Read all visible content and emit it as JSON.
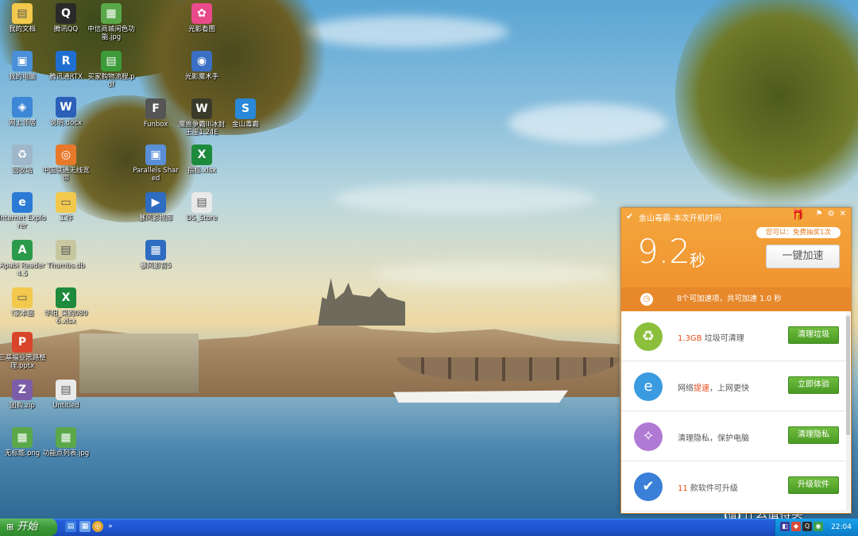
{
  "desktop_icons": [
    {
      "label": "我的文档",
      "icon": "folder-documents-icon",
      "color": "#f2c94c",
      "glyph": "▤"
    },
    {
      "label": "我的电脑",
      "icon": "computer-icon",
      "color": "#4a8fd8",
      "glyph": "▣"
    },
    {
      "label": "网上邻居",
      "icon": "network-icon",
      "color": "#3e86d6",
      "glyph": "◈"
    },
    {
      "label": "回收站",
      "icon": "recycle-bin-icon",
      "color": "#9fb7c9",
      "glyph": "♻"
    },
    {
      "label": "Internet Explorer",
      "icon": "ie-icon",
      "color": "#2b7bd6",
      "glyph": "e"
    },
    {
      "label": "Apabi Reader 4.5",
      "icon": "apabi-reader-icon",
      "color": "#2b9a4a",
      "glyph": "A"
    },
    {
      "label": "!家本届",
      "icon": "folder-icon",
      "color": "#f2c94c",
      "glyph": "▭"
    },
    {
      "label": "三基福业思路整理.pptx",
      "icon": "pptx-icon",
      "color": "#d9452b",
      "glyph": "P"
    },
    {
      "label": "团购.zip",
      "icon": "zip-icon",
      "color": "#7b5ea7",
      "glyph": "Z"
    },
    {
      "label": "无标题.png",
      "icon": "png-icon",
      "color": "#5aa84a",
      "glyph": "▦"
    },
    {
      "label": "腾讯QQ",
      "icon": "qq-icon",
      "color": "#2a2a2a",
      "glyph": "Q"
    },
    {
      "label": "腾讯通RTX",
      "icon": "rtx-icon",
      "color": "#1f6fd1",
      "glyph": "R"
    },
    {
      "label": "说明.docx",
      "icon": "docx-icon",
      "color": "#2b5fb8",
      "glyph": "W"
    },
    {
      "label": "中国联通无线宽带",
      "icon": "unicom-icon",
      "color": "#e8792b",
      "glyph": "◎"
    },
    {
      "label": "工作",
      "icon": "folder-icon",
      "color": "#f2c94c",
      "glyph": "▭"
    },
    {
      "label": "Thumbs.db",
      "icon": "db-file-icon",
      "color": "#c7c7a0",
      "glyph": "▤"
    },
    {
      "label": "华阳_采购0806.xlsx",
      "icon": "xlsx-icon",
      "color": "#1e8a3c",
      "glyph": "X"
    },
    {
      "label": "Untitled",
      "icon": "file-icon",
      "color": "#e9e9e9",
      "glyph": "▤"
    },
    {
      "label": "功能点列表.jpg",
      "icon": "jpg-icon",
      "color": "#5aa84a",
      "glyph": "▦"
    },
    {
      "label": "中信商城闲色功能.jpg",
      "icon": "jpg-icon",
      "color": "#5aa84a",
      "glyph": "▦"
    },
    {
      "label": "买家购物流程.pdf",
      "icon": "pdf-icon",
      "color": "#3c9a38",
      "glyph": "▤"
    },
    {
      "label": "光影看图",
      "icon": "photo-viewer-icon",
      "color": "#e84a8a",
      "glyph": "✿"
    },
    {
      "label": "光影魔术手",
      "icon": "photo-editor-icon",
      "color": "#3a6fc4",
      "glyph": "◉"
    },
    {
      "label": "Funbox",
      "icon": "funbox-icon",
      "color": "#555",
      "glyph": "F"
    },
    {
      "label": "魔兽争霸III冰封王座1.24E",
      "icon": "warcraft-icon",
      "color": "#3a3a2a",
      "glyph": "W"
    },
    {
      "label": "金山毒霸",
      "icon": "kingsoft-icon",
      "color": "#2a88d8",
      "glyph": "S"
    },
    {
      "label": "Parallels Shared",
      "icon": "parallels-icon",
      "color": "#5a8fd8",
      "glyph": "▣"
    },
    {
      "label": "指标.xlsx",
      "icon": "xlsx-icon",
      "color": "#1e8a3c",
      "glyph": "X"
    },
    {
      "label": "暴风影视库",
      "icon": "baofeng-icon",
      "color": "#2e6cc2",
      "glyph": "▶"
    },
    {
      "label": "DS_Store",
      "icon": "file-icon",
      "color": "#e9e9e9",
      "glyph": "▤"
    },
    {
      "label": "暴风影音5",
      "icon": "baofeng-player-icon",
      "color": "#2e6cc2",
      "glyph": "▦"
    }
  ],
  "popup": {
    "title": "金山毒霸-本次开机时间",
    "promo": "您可以：免费抽奖1次",
    "boot_time": "9.2",
    "boot_unit": "秒",
    "accelerate_label": "一键加速",
    "summary": "8个可加速项，共可加速 1.0 秒",
    "rows": [
      {
        "highlight": "1.3GB",
        "text": " 垃圾可清理",
        "button": "清理垃圾",
        "icon": "recycle-icon",
        "color": "#8bbf3c",
        "glyph": "♻"
      },
      {
        "pre": "网络",
        "highlight": "提速",
        "text": "，上网更快",
        "button": "立即体验",
        "icon": "ie-icon",
        "color": "#3a9be0",
        "glyph": "e"
      },
      {
        "text": "清理隐私，保护电脑",
        "button": "清理隐私",
        "icon": "broom-icon",
        "color": "#b07ad4",
        "glyph": "✧"
      },
      {
        "highlight": "11",
        "text": " 款软件可升级",
        "button": "升级软件",
        "icon": "update-icon",
        "color": "#3a7fd8",
        "glyph": "✔"
      }
    ]
  },
  "taskbar": {
    "start_label": "开始",
    "clock": "22:04"
  },
  "watermark": {
    "circle": "值",
    "text": "什么值得买"
  }
}
